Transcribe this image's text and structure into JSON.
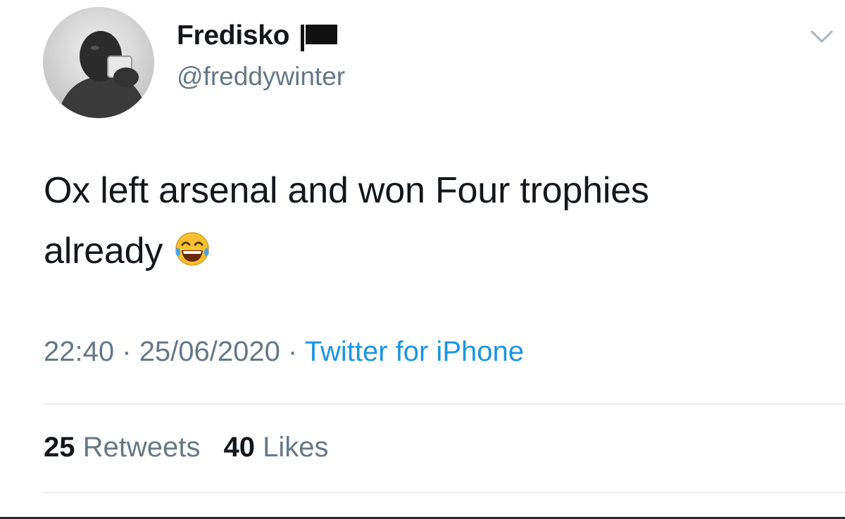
{
  "author": {
    "display_name": "Fredisko",
    "handle": "@freddywinter",
    "avatar_icon": "avatar-photo",
    "name_badge_icon": "black-flag-icon"
  },
  "tweet": {
    "text_line1": "Ox left arsenal and won Four trophies",
    "text_line2": "already",
    "emoji_icon": "face-with-tears-of-joy-icon"
  },
  "meta": {
    "time": "22:40",
    "separator": "·",
    "date": "25/06/2020",
    "source": "Twitter for iPhone"
  },
  "stats": {
    "retweets_count": "25",
    "retweets_label": "Retweets",
    "likes_count": "40",
    "likes_label": "Likes"
  },
  "colors": {
    "text": "#14171a",
    "secondary": "#657786",
    "link": "#1b95e0",
    "divider": "#d6dbdf"
  }
}
